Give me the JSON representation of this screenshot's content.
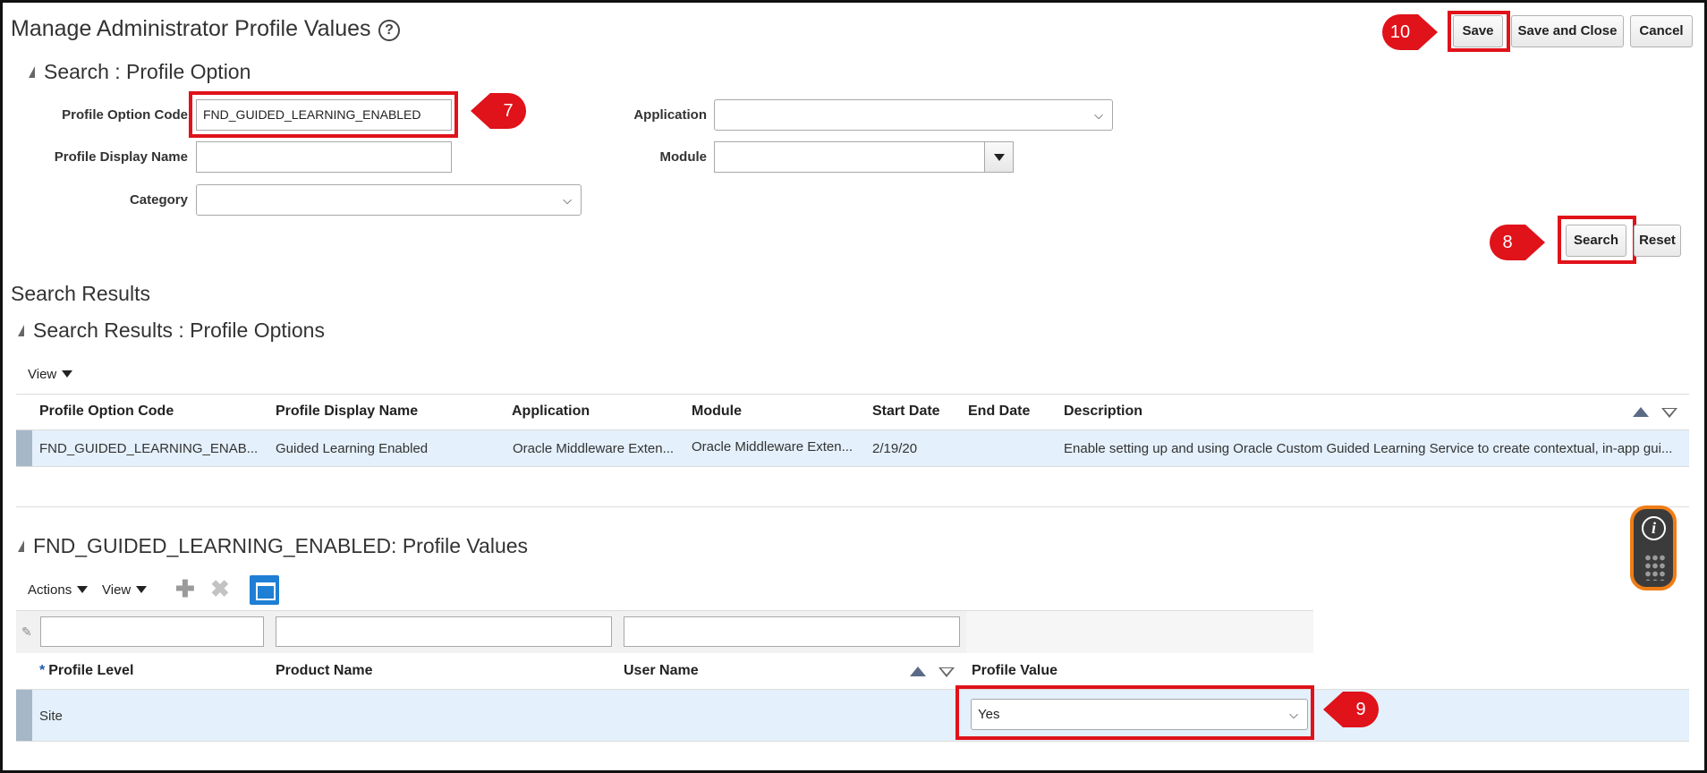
{
  "page": {
    "title": "Manage Administrator Profile Values",
    "help_icon": "?"
  },
  "toolbar": {
    "save": "Save",
    "save_and_close": "Save and Close",
    "cancel": "Cancel"
  },
  "search": {
    "section_title": "Search : Profile Option",
    "profile_option_code_label": "Profile Option Code",
    "profile_option_code_value": "FND_GUIDED_LEARNING_ENABLED",
    "profile_display_name_label": "Profile Display Name",
    "profile_display_name_value": "",
    "category_label": "Category",
    "category_value": "",
    "application_label": "Application",
    "application_value": "",
    "module_label": "Module",
    "module_value": "",
    "search_button": "Search",
    "reset_button": "Reset"
  },
  "results": {
    "heading": "Search Results",
    "section_title": "Search Results : Profile Options",
    "view_menu": "View",
    "columns": [
      "Profile Option Code",
      "Profile Display Name",
      "Application",
      "Module",
      "Start Date",
      "End Date",
      "Description"
    ],
    "rows": [
      {
        "code": "FND_GUIDED_LEARNING_ENAB...",
        "display_name": "Guided Learning Enabled",
        "application": "Oracle Middleware Exten...",
        "module": "Oracle Middleware Exten...",
        "start_date": "2/19/20",
        "end_date": "",
        "description": "Enable setting up and using Oracle Custom Guided Learning Service to create contextual, in-app gui..."
      }
    ]
  },
  "profile_values": {
    "section_title": "FND_GUIDED_LEARNING_ENABLED: Profile Values",
    "actions_menu": "Actions",
    "view_menu": "View",
    "columns": [
      "Profile Level",
      "Product Name",
      "User Name",
      "Profile Value"
    ],
    "required_marker": "*",
    "rows": [
      {
        "level": "Site",
        "product": "",
        "user": "",
        "value": "Yes"
      }
    ]
  },
  "annotations": {
    "step_7": "7",
    "step_8": "8",
    "step_9": "9",
    "step_10": "10",
    "highlight_color": "#e0121a"
  },
  "icons": [
    "help-icon",
    "add-icon",
    "delete-icon",
    "freeze-icon",
    "info-icon",
    "sort-ascending-icon",
    "sort-descending-icon",
    "chevron-down-icon",
    "collapse-triangle-icon"
  ]
}
